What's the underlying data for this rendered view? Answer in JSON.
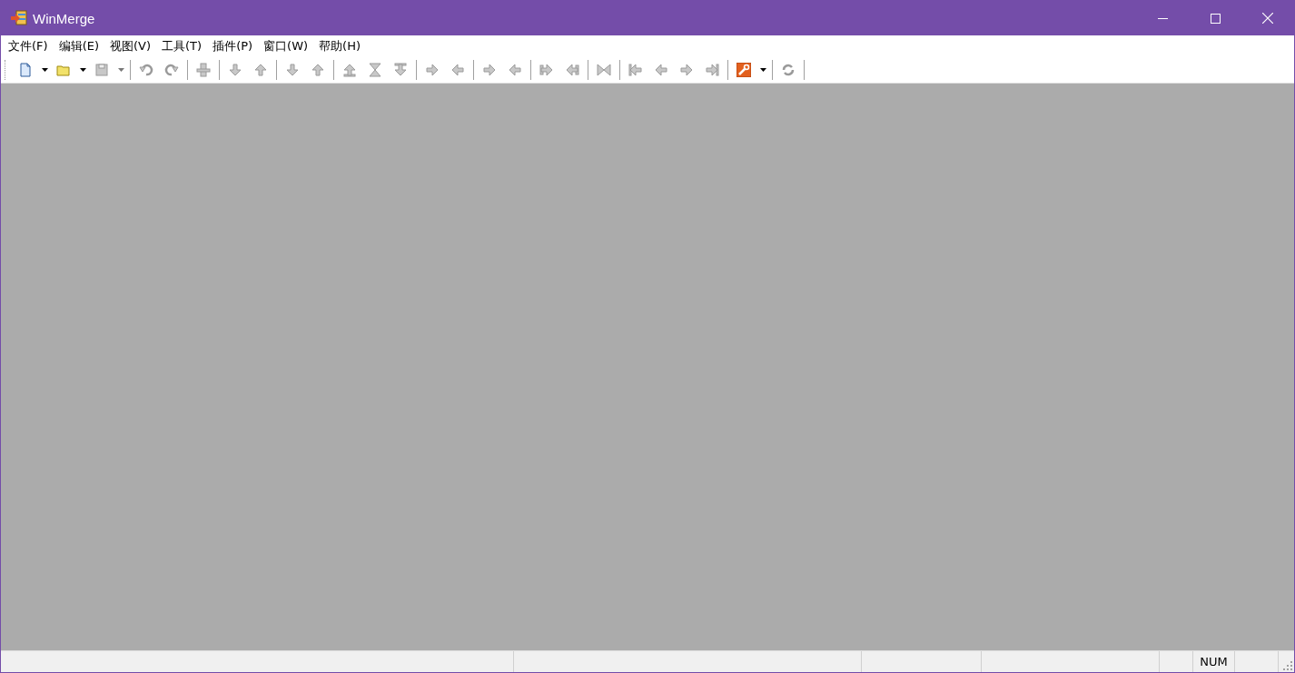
{
  "window": {
    "title": "WinMerge"
  },
  "menu": [
    {
      "label": "文件(F)"
    },
    {
      "label": "编辑(E)"
    },
    {
      "label": "视图(V)"
    },
    {
      "label": "工具(T)"
    },
    {
      "label": "插件(P)"
    },
    {
      "label": "窗口(W)"
    },
    {
      "label": "帮助(H)"
    }
  ],
  "toolbar": [
    {
      "kind": "button",
      "disabled": false
    },
    {
      "kind": "dropdown",
      "disabled": false
    },
    {
      "kind": "button",
      "disabled": false
    },
    {
      "kind": "dropdown",
      "disabled": false
    },
    {
      "kind": "button",
      "disabled": true
    },
    {
      "kind": "dropdown",
      "disabled": true
    },
    {
      "kind": "separator"
    },
    {
      "kind": "button",
      "disabled": true
    },
    {
      "kind": "button",
      "disabled": true
    },
    {
      "kind": "separator"
    },
    {
      "kind": "button",
      "disabled": true
    },
    {
      "kind": "separator"
    },
    {
      "kind": "button",
      "disabled": true
    },
    {
      "kind": "button",
      "disabled": true
    },
    {
      "kind": "separator"
    },
    {
      "kind": "button",
      "disabled": true
    },
    {
      "kind": "button",
      "disabled": true
    },
    {
      "kind": "separator"
    },
    {
      "kind": "button",
      "disabled": true
    },
    {
      "kind": "button",
      "disabled": true
    },
    {
      "kind": "button",
      "disabled": true
    },
    {
      "kind": "separator"
    },
    {
      "kind": "button",
      "disabled": true
    },
    {
      "kind": "button",
      "disabled": true
    },
    {
      "kind": "separator"
    },
    {
      "kind": "button",
      "disabled": true
    },
    {
      "kind": "button",
      "disabled": true
    },
    {
      "kind": "separator"
    },
    {
      "kind": "button",
      "disabled": true
    },
    {
      "kind": "button",
      "disabled": true
    },
    {
      "kind": "separator"
    },
    {
      "kind": "button",
      "disabled": true
    },
    {
      "kind": "separator"
    },
    {
      "kind": "button",
      "disabled": true
    },
    {
      "kind": "button",
      "disabled": true
    },
    {
      "kind": "button",
      "disabled": true
    },
    {
      "kind": "button",
      "disabled": true
    },
    {
      "kind": "separator"
    },
    {
      "kind": "button",
      "disabled": false
    },
    {
      "kind": "dropdown",
      "disabled": false
    },
    {
      "kind": "separator"
    },
    {
      "kind": "button",
      "disabled": true
    },
    {
      "kind": "separator"
    }
  ],
  "status_bar": {
    "indicators": [
      {
        "text": "NUM"
      }
    ]
  }
}
